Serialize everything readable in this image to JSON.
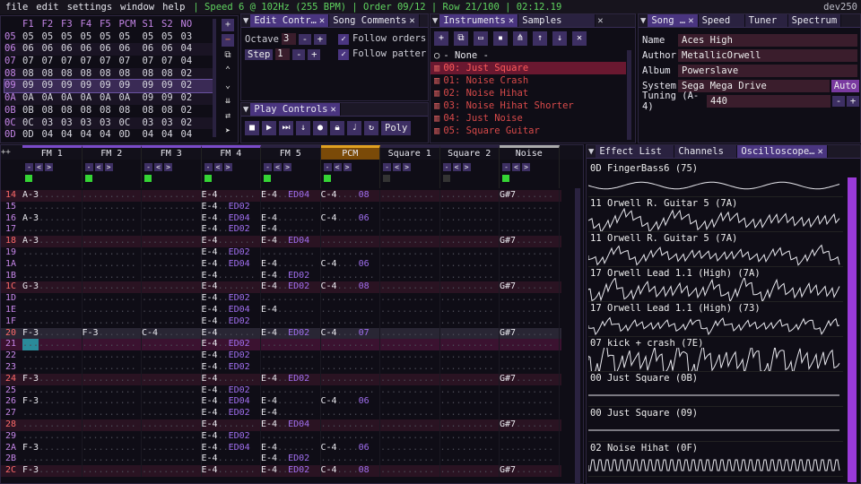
{
  "menu": {
    "items": [
      "file",
      "edit",
      "settings",
      "window",
      "help"
    ],
    "status": "| Speed 6 @ 102Hz (255 BPM) | Order 09/12 | Row 21/100 | 02:12.19",
    "version": "dev250"
  },
  "orders": {
    "headers": [
      "",
      "F1",
      "F2",
      "F3",
      "F4",
      "F5",
      "PCM",
      "S1",
      "S2",
      "NO"
    ],
    "rows": [
      [
        "05",
        "05",
        "05",
        "05",
        "05",
        "05",
        "05",
        "05",
        "03"
      ],
      [
        "06",
        "06",
        "06",
        "06",
        "06",
        "06",
        "06",
        "06",
        "04"
      ],
      [
        "07",
        "07",
        "07",
        "07",
        "07",
        "07",
        "07",
        "07",
        "04"
      ],
      [
        "08",
        "08",
        "08",
        "08",
        "08",
        "08",
        "08",
        "08",
        "02"
      ],
      [
        "09",
        "09",
        "09",
        "09",
        "09",
        "09",
        "09",
        "09",
        "02"
      ],
      [
        "0A",
        "0A",
        "0A",
        "0A",
        "0A",
        "0A",
        "09",
        "09",
        "02"
      ],
      [
        "0B",
        "08",
        "08",
        "08",
        "08",
        "08",
        "08",
        "08",
        "02"
      ],
      [
        "0C",
        "03",
        "03",
        "03",
        "03",
        "0C",
        "03",
        "03",
        "02"
      ],
      [
        "0D",
        "04",
        "04",
        "04",
        "04",
        "0D",
        "04",
        "04",
        "04"
      ]
    ],
    "row_labels": [
      "05",
      "06",
      "07",
      "08",
      "09",
      "0A",
      "0B",
      "0C",
      "0D"
    ],
    "buttons": [
      "+",
      "−",
      "⧉",
      "⌃",
      "⌄",
      "⇊",
      "⇄",
      "➤"
    ]
  },
  "edit": {
    "title": "Edit Contr…",
    "tab2": "Song Comments",
    "octave_label": "Octave",
    "octave": "3",
    "step_label": "Step",
    "step": "1",
    "follow_orders": "Follow orders",
    "follow_pattern": "Follow patter"
  },
  "play": {
    "title": "Play Controls",
    "poly": "Poly"
  },
  "instruments": {
    "title": "Instruments",
    "tab2": "Samples",
    "none": "- None -",
    "items": [
      "00: Just Square",
      "01: Noise Crash",
      "02: Noise Hihat",
      "03: Noise Hihat Shorter",
      "04: Just Noise",
      "05: Square Guitar"
    ]
  },
  "song": {
    "tabs": [
      "Song …",
      "Speed",
      "Tuner",
      "Spectrum"
    ],
    "name_label": "Name",
    "name": "Aces High",
    "author_label": "Author",
    "author": "MetallicOrwell",
    "album_label": "Album",
    "album": "Powerslave",
    "system_label": "System",
    "system": "Sega Mega Drive",
    "auto": "Auto",
    "tuning_label": "Tuning (A-4)",
    "tuning": "440"
  },
  "channels": [
    "FM 1",
    "FM 2",
    "FM 3",
    "FM 4",
    "FM 5",
    "PCM",
    "Square 1",
    "Square 2",
    "Noise"
  ],
  "pattern": [
    {
      "r": "14",
      "c": {
        "0": "A-3",
        "3": "E-4",
        "4": "E-4|ED04",
        "5": "C-4|08",
        "8": "G#7"
      }
    },
    {
      "r": "15",
      "c": {
        "3": "E-4|ED02"
      }
    },
    {
      "r": "16",
      "c": {
        "0": "A-3",
        "3": "E-4|ED04",
        "4": "E-4",
        "5": "C-4|06"
      }
    },
    {
      "r": "17",
      "c": {
        "3": "E-4|ED02",
        "4": "E-4"
      }
    },
    {
      "r": "18",
      "c": {
        "0": "A-3",
        "3": "E-4",
        "4": "E-4|ED04",
        "8": "G#7"
      }
    },
    {
      "r": "19",
      "c": {
        "3": "E-4|ED02"
      }
    },
    {
      "r": "1A",
      "c": {
        "3": "E-4|ED04",
        "4": "E-4",
        "5": "C-4|06"
      }
    },
    {
      "r": "1B",
      "c": {
        "3": "E-4",
        "4": "E-4|ED02"
      }
    },
    {
      "r": "1C",
      "c": {
        "0": "G-3",
        "3": "E-4",
        "4": "E-4|ED02",
        "5": "C-4|08",
        "8": "G#7"
      }
    },
    {
      "r": "1D",
      "c": {
        "3": "E-4|ED02"
      }
    },
    {
      "r": "1E",
      "c": {
        "3": "E-4|ED04",
        "4": "E-4"
      }
    },
    {
      "r": "1F",
      "c": {
        "3": "E-4|ED02"
      }
    },
    {
      "r": "20",
      "c": {
        "0": "F-3",
        "1": "F-3",
        "2": "C-4",
        "3": "E-4",
        "4": "E-4|ED02",
        "5": "C-4|07",
        "8": "G#7"
      }
    },
    {
      "r": "21",
      "c": {
        "3": "E-4|ED02"
      }
    },
    {
      "r": "22",
      "c": {
        "3": "E-4|ED02"
      }
    },
    {
      "r": "23",
      "c": {
        "3": "E-4|ED02"
      }
    },
    {
      "r": "24",
      "c": {
        "0": "F-3",
        "3": "E-4",
        "4": "E-4|ED02",
        "8": "G#7"
      }
    },
    {
      "r": "25",
      "c": {
        "3": "E-4|ED02"
      }
    },
    {
      "r": "26",
      "c": {
        "0": "F-3",
        "3": "E-4|ED04",
        "4": "E-4",
        "5": "C-4|06"
      }
    },
    {
      "r": "27",
      "c": {
        "3": "E-4|ED02",
        "4": "E-4"
      }
    },
    {
      "r": "28",
      "c": {
        "3": "E-4",
        "4": "E-4|ED04",
        "8": "G#7"
      }
    },
    {
      "r": "29",
      "c": {
        "3": "E-4|ED02"
      }
    },
    {
      "r": "2A",
      "c": {
        "0": "F-3",
        "3": "E-4|ED04",
        "4": "E-4",
        "5": "C-4|06"
      }
    },
    {
      "r": "2B",
      "c": {
        "3": "E-4",
        "4": "E-4|ED02"
      }
    },
    {
      "r": "2C",
      "c": {
        "0": "F-3",
        "3": "E-4",
        "4": "E-4|ED02",
        "5": "C-4|08",
        "8": "G#7"
      }
    }
  ],
  "osc": {
    "tabs": [
      "Effect List",
      "Channels",
      "Oscilloscope…"
    ],
    "items": [
      "0D FingerBass6 (75)",
      "11 Orwell R. Guitar 5 (7A)",
      "11 Orwell R. Guitar 5 (7A)",
      "17 Orwell Lead 1.1 (High) (7A)",
      "17 Orwell Lead 1.1 (High) (73)",
      "07 kick + crash (7E)",
      "00 Just Square (0B)",
      "00 Just Square (09)",
      "02 Noise Hihat (0F)"
    ]
  },
  "colors": {
    "accent": "#4a3580",
    "note": "#e8e8ee",
    "effect": "#a16ff0",
    "row": "#c586e8",
    "instrument": "#d94a4a",
    "green": "#5fd35f"
  }
}
